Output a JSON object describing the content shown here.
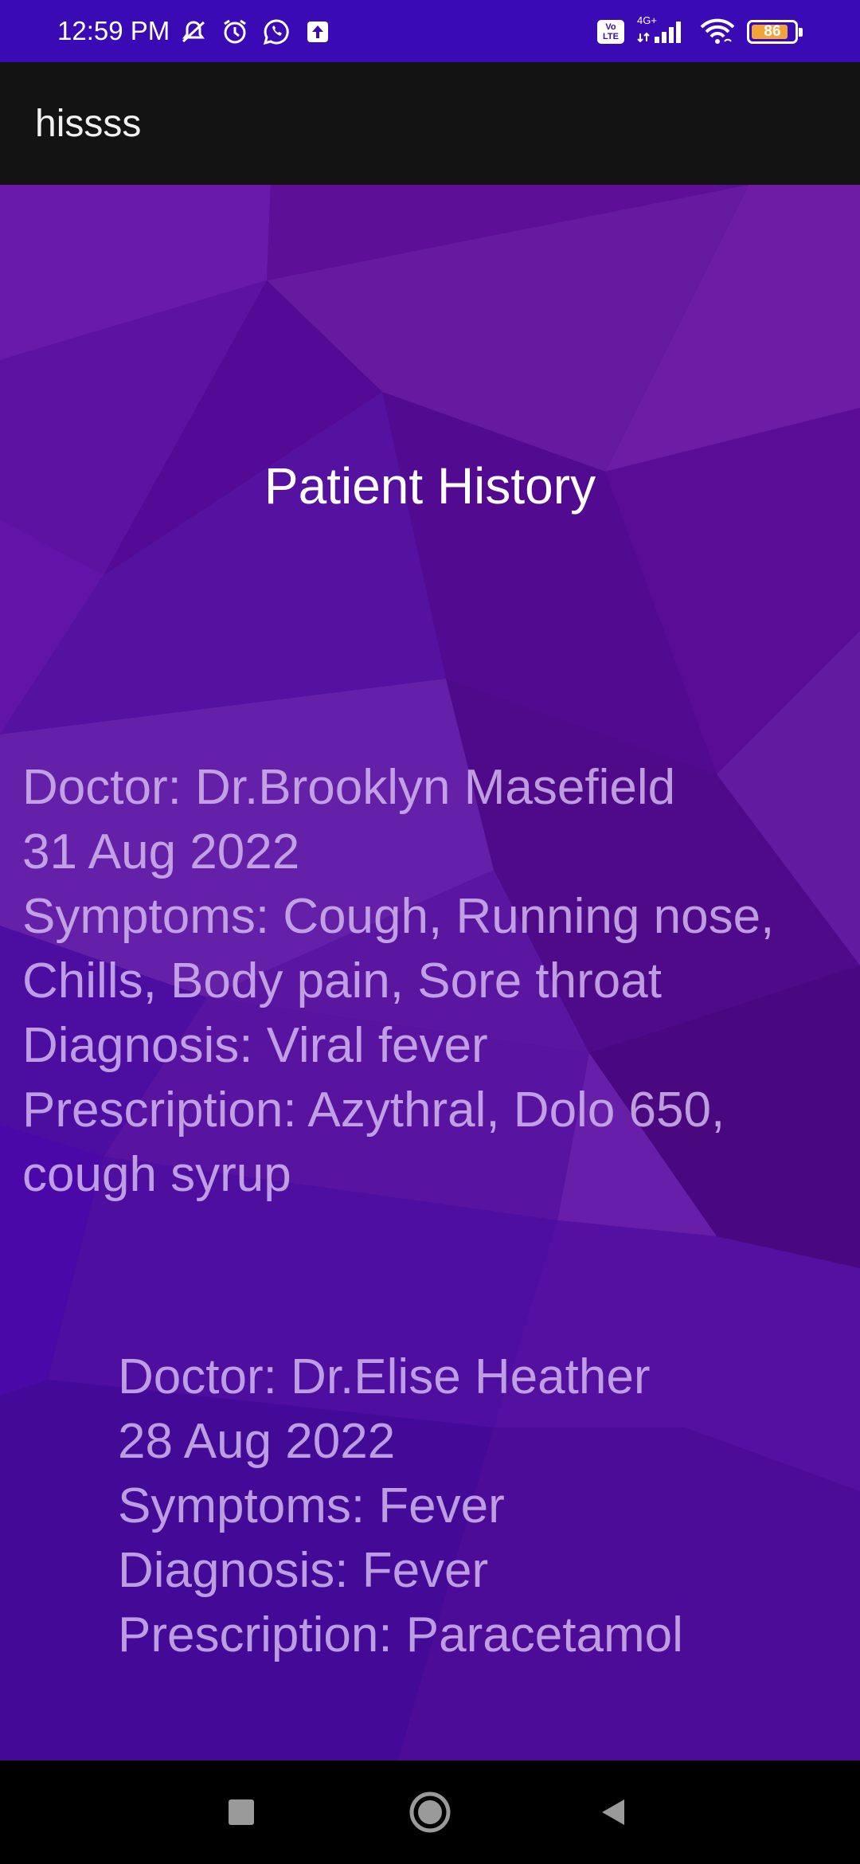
{
  "status_bar": {
    "time": "12:59 PM",
    "battery_level": "86",
    "battery_fraction": 0.86,
    "network_label": "4G+",
    "volte_label": "Vo LTE",
    "left_icons": [
      "mute-vibrate-icon",
      "alarm-icon",
      "whatsapp-icon",
      "upload-icon"
    ],
    "right_icons": [
      "volte-icon",
      "signal-icon",
      "wifi-icon",
      "battery-icon"
    ]
  },
  "app_bar": {
    "title": "hissss"
  },
  "page": {
    "title": "Patient History"
  },
  "records": [
    {
      "doctor": "Doctor: Dr.Brooklyn Masefield",
      "date": "31 Aug 2022",
      "symptoms_line1": "Symptoms: Cough, Running nose,",
      "symptoms_line2": "Chills, Body pain, Sore throat",
      "diagnosis": "Diagnosis: Viral fever",
      "prescription_line1": "Prescription: Azythral, Dolo 650,",
      "prescription_line2": "cough syrup"
    },
    {
      "doctor": "Doctor: Dr.Elise Heather",
      "date": "28 Aug 2022",
      "symptoms_line1": "Symptoms: Fever",
      "diagnosis": "Diagnosis: Fever",
      "prescription_line1": "Prescription: Paracetamol"
    }
  ],
  "nav_bar": {
    "buttons": [
      "recents-icon",
      "home-icon",
      "back-icon"
    ]
  },
  "colors": {
    "status_bar": "#3a0ab5",
    "app_bar": "#131313",
    "background_primary": "#4a0a8a",
    "record_text": "#d7bef0",
    "title_text": "#ffffff"
  }
}
